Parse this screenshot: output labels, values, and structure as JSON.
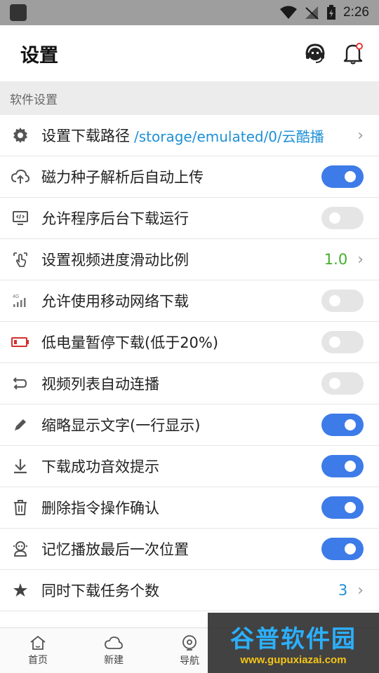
{
  "status_bar": {
    "time": "2:26"
  },
  "header": {
    "title": "设置"
  },
  "section": {
    "title": "软件设置"
  },
  "settings": [
    {
      "label": "设置下载路径",
      "path": "/storage/emulated/0/云酷播",
      "control": "chevron"
    },
    {
      "label": "磁力种子解析后自动上传",
      "control": "toggle",
      "on": true
    },
    {
      "label": "允许程序后台下载运行",
      "control": "toggle",
      "on": false
    },
    {
      "label": "设置视频进度滑动比例",
      "value": "1.0",
      "control": "chevron"
    },
    {
      "label": "允许使用移动网络下载",
      "control": "toggle",
      "on": false
    },
    {
      "label": "低电量暂停下载(低于20%)",
      "control": "toggle",
      "on": false
    },
    {
      "label": "视频列表自动连播",
      "control": "toggle",
      "on": false
    },
    {
      "label": "缩略显示文字(一行显示)",
      "control": "toggle",
      "on": true
    },
    {
      "label": "下载成功音效提示",
      "control": "toggle",
      "on": true
    },
    {
      "label": "删除指令操作确认",
      "control": "toggle",
      "on": true
    },
    {
      "label": "记忆播放最后一次位置",
      "control": "toggle",
      "on": true
    },
    {
      "label": "同时下载任务个数",
      "value": "3",
      "control": "chevron"
    }
  ],
  "bottom_nav": [
    {
      "label": "首页",
      "icon": "home-icon"
    },
    {
      "label": "新建",
      "icon": "cloud-icon"
    },
    {
      "label": "导航",
      "icon": "compass-icon"
    }
  ],
  "watermark": {
    "title": "谷普软件园",
    "url": "www.gupuxiazai.com"
  },
  "colors": {
    "accent": "#3d7be8",
    "link": "#1e90d6",
    "green": "#43b02a"
  }
}
